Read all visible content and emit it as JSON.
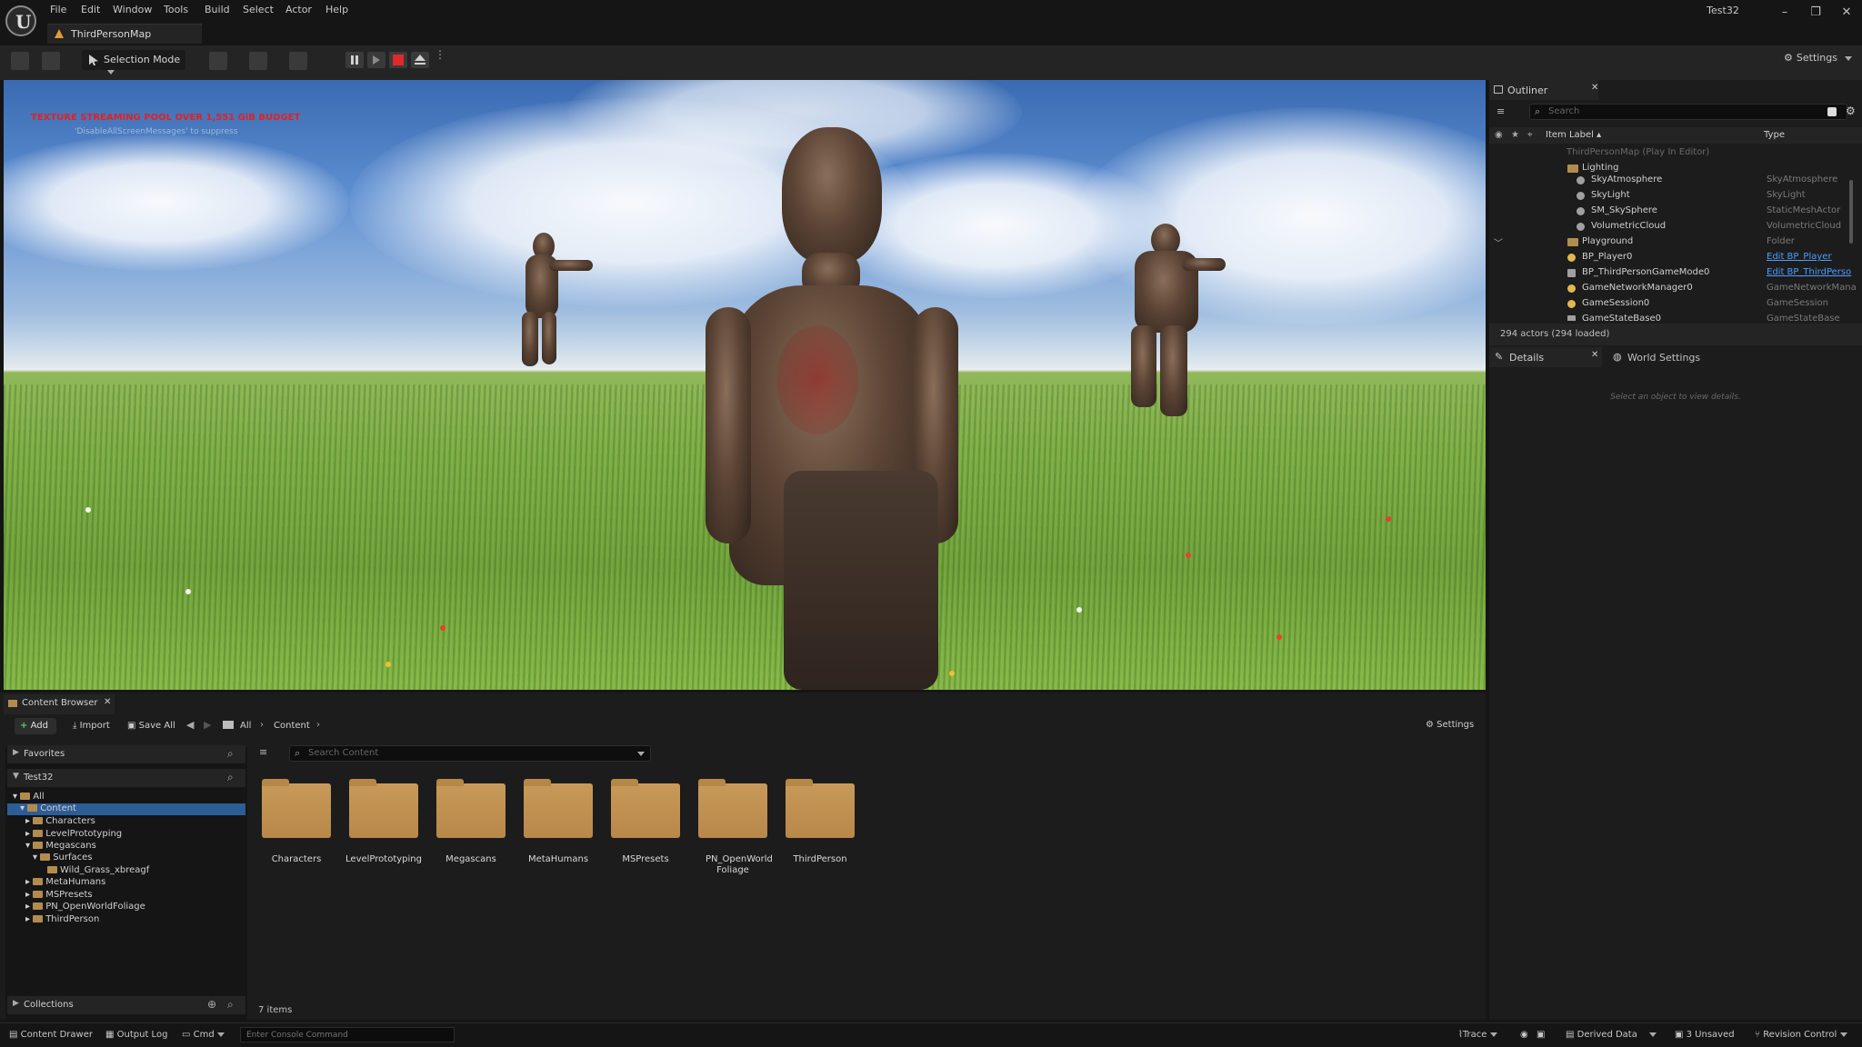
{
  "titlebar": {
    "menu": [
      "File",
      "Edit",
      "Window",
      "Tools",
      "Build",
      "Select",
      "Actor",
      "Help"
    ],
    "map_tab": "ThirdPersonMap",
    "project": "Test32",
    "minimize": "–",
    "maximize": "❐",
    "close": "✕"
  },
  "toolbar": {
    "selection_mode": "Selection Mode",
    "settings": "Settings"
  },
  "viewport": {
    "warning": "TEXTURE STREAMING POOL OVER 1,551 GiB BUDGET",
    "hint": "'DisableAllScreenMessages' to suppress"
  },
  "outliner": {
    "tab": "Outliner",
    "search_placeholder": "Search",
    "col_label": "Item Label ▴",
    "col_type": "Type",
    "rows": [
      {
        "label": "ThirdPersonMap (Play In Editor)",
        "type": ""
      },
      {
        "label": "Lighting",
        "type": ""
      },
      {
        "label": "SkyAtmosphere",
        "type": "SkyAtmosphere"
      },
      {
        "label": "SkyLight",
        "type": "SkyLight"
      },
      {
        "label": "SM_SkySphere",
        "type": "StaticMeshActor"
      },
      {
        "label": "VolumetricCloud",
        "type": "VolumetricCloud"
      },
      {
        "label": "Playground",
        "type": "Folder"
      },
      {
        "label": "BP_Player0",
        "type": "Edit BP_Player"
      },
      {
        "label": "BP_ThirdPersonGameMode0",
        "type": "Edit BP_ThirdPerso"
      },
      {
        "label": "GameNetworkManager0",
        "type": "GameNetworkMana"
      },
      {
        "label": "GameSession0",
        "type": "GameSession"
      },
      {
        "label": "GameStateBase0",
        "type": "GameStateBase"
      }
    ],
    "status": "294 actors (294 loaded)"
  },
  "details": {
    "tab": "Details",
    "world_settings_tab": "World Settings",
    "empty_text": "Select an object to view details."
  },
  "content_browser": {
    "tab": "Content Browser",
    "add": "Add",
    "import": "Import",
    "save_all": "Save All",
    "path_all": "All",
    "path_content": "Content",
    "settings": "Settings",
    "favorites": "Favorites",
    "project": "Test32",
    "search_placeholder": "Search Content",
    "tree": [
      "All",
      "Content",
      "Characters",
      "LevelPrototyping",
      "Megascans",
      "Surfaces",
      "Wild_Grass_xbreagf",
      "MetaHumans",
      "MSPresets",
      "PN_OpenWorldFoliage",
      "ThirdPerson"
    ],
    "assets": [
      "Characters",
      "LevelPrototyping",
      "Megascans",
      "MetaHumans",
      "MSPresets",
      "PN_OpenWorld Foliage",
      "ThirdPerson"
    ],
    "item_count": "7 items",
    "collections": "Collections"
  },
  "statusbar": {
    "content_drawer": "Content Drawer",
    "output_log": "Output Log",
    "cmd": "Cmd",
    "console_placeholder": "Enter Console Command",
    "trace": "Trace",
    "derived_data": "Derived Data",
    "unsaved": "3 Unsaved",
    "revision_control": "Revision Control"
  },
  "colors": {
    "accent_selected": "#2c5d96",
    "warning_red": "#e02222",
    "folder": "#c79a59",
    "link": "#4d9dff"
  }
}
